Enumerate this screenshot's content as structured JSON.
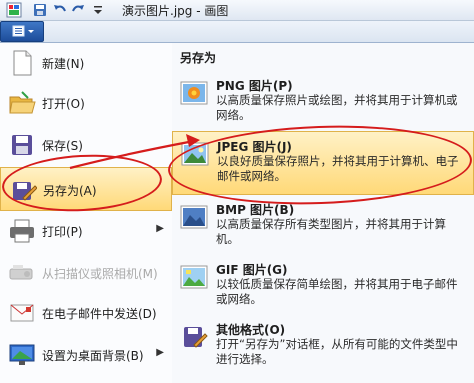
{
  "window": {
    "title": "演示图片.jpg - 画图"
  },
  "file_menu": {
    "left_items": [
      {
        "label": "新建(N)",
        "icon": "new-document-icon"
      },
      {
        "label": "打开(O)",
        "icon": "open-folder-icon"
      },
      {
        "label": "保存(S)",
        "icon": "save-disk-icon"
      },
      {
        "label": "另存为(A)",
        "icon": "save-as-icon"
      },
      {
        "label": "打印(P)",
        "icon": "printer-icon"
      },
      {
        "label": "从扫描仪或照相机(M)",
        "icon": "scanner-icon"
      },
      {
        "label": "在电子邮件中发送(D)",
        "icon": "email-icon"
      },
      {
        "label": "设置为桌面背景(B)",
        "icon": "desktop-background-icon"
      }
    ],
    "save_as_panel": {
      "title": "另存为",
      "items": [
        {
          "name": "PNG 图片(P)",
          "desc": "以高质量保存照片或绘图，并将其用于计算机或网络。",
          "icon": "png-image-icon"
        },
        {
          "name": "JPEG 图片(J)",
          "desc": "以良好质量保存照片，并将其用于计算机、电子邮件或网络。",
          "icon": "jpeg-image-icon"
        },
        {
          "name": "BMP 图片(B)",
          "desc": "以高质量保存所有类型图片，并将其用于计算机。",
          "icon": "bmp-image-icon"
        },
        {
          "name": "GIF 图片(G)",
          "desc": "以较低质量保存简单绘图，并将其用于电子邮件或网络。",
          "icon": "gif-image-icon"
        },
        {
          "name": "其他格式(O)",
          "desc": "打开“另存为”对话框，从所有可能的文件类型中进行选择。",
          "icon": "other-formats-icon"
        }
      ]
    }
  },
  "colors": {
    "highlight": "#ffd978",
    "annotation": "#d51c1c",
    "menu_button": "#2b5eb0"
  }
}
